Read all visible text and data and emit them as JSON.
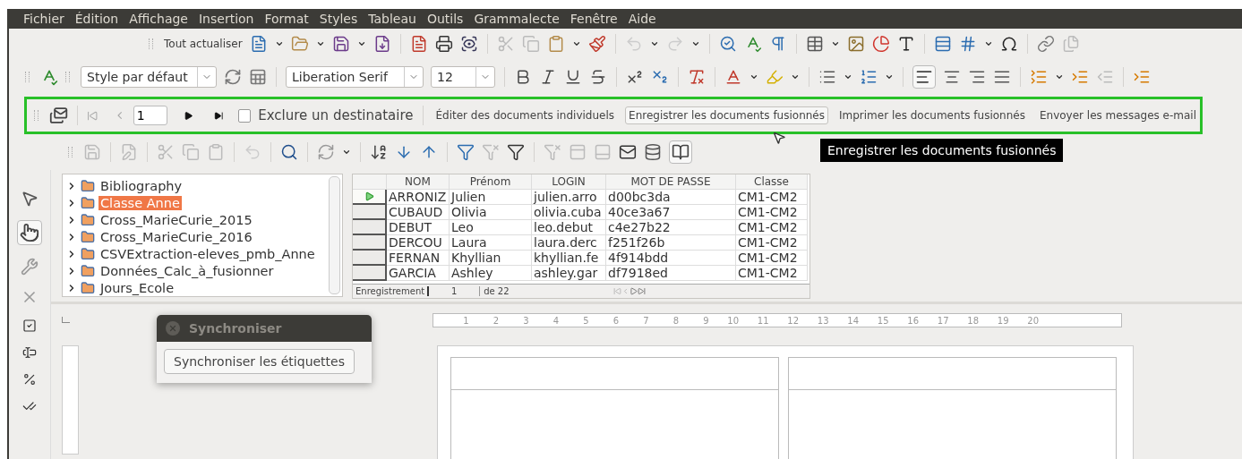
{
  "menu": [
    "Fichier",
    "Édition",
    "Affichage",
    "Insertion",
    "Format",
    "Styles",
    "Tableau",
    "Outils",
    "Grammalecte",
    "Fenêtre",
    "Aide"
  ],
  "standard_toolbar": {
    "update_all": "Tout actualiser"
  },
  "formatting_toolbar": {
    "paragraph_style": "Style par défaut",
    "font_name": "Liberation Serif",
    "font_size": "12"
  },
  "mail_merge_toolbar": {
    "record": "1",
    "exclude": {
      "label": "Exclure un destinataire",
      "checked": false
    },
    "actions": [
      {
        "label": "Éditer des documents individuels",
        "hovered": false
      },
      {
        "label": "Enregistrer les documents fusionnés",
        "hovered": true
      },
      {
        "label": "Imprimer les documents fusionnés",
        "hovered": false
      },
      {
        "label": "Envoyer les messages e-mail",
        "hovered": false
      }
    ]
  },
  "tooltip": "Enregistrer les documents fusionnés",
  "data_sources": {
    "items": [
      {
        "label": "Bibliography",
        "selected": false,
        "expanded": false
      },
      {
        "label": "Classe Anne",
        "selected": true,
        "expanded": false
      },
      {
        "label": "Cross_MarieCurie_2015",
        "selected": false,
        "expanded": false
      },
      {
        "label": "Cross_MarieCurie_2016",
        "selected": false,
        "expanded": false
      },
      {
        "label": "CSVExtraction-eleves_pmb_Anne",
        "selected": false,
        "expanded": false
      },
      {
        "label": "Données_Calc_à_fusionner",
        "selected": false,
        "expanded": false
      },
      {
        "label": "Jours_Ecole",
        "selected": false,
        "expanded": false
      }
    ]
  },
  "table": {
    "columns": [
      "NOM",
      "Prénom",
      "LOGIN",
      "MOT DE PASSE",
      "Classe"
    ],
    "rows": [
      {
        "selected": true,
        "cells": [
          "ARRONIZ",
          "Julien",
          "julien.arro",
          "d00bc3da",
          "CM1-CM2"
        ]
      },
      {
        "selected": false,
        "cells": [
          "CUBAUD",
          "Olivia",
          "olivia.cuba",
          "40ce3a67",
          "CM1-CM2"
        ]
      },
      {
        "selected": false,
        "cells": [
          "DEBUT",
          "Leo",
          "leo.debut",
          "c4e27b22",
          "CM1-CM2"
        ]
      },
      {
        "selected": false,
        "cells": [
          "DERCOU",
          "Laura",
          "laura.derc",
          "f251f26b",
          "CM1-CM2"
        ]
      },
      {
        "selected": false,
        "cells": [
          "FERNAN",
          "Khyllian",
          "khyllian.fe",
          "4f914bdd",
          "CM1-CM2"
        ]
      },
      {
        "selected": false,
        "cells": [
          "GARCIA",
          "Ashley",
          "ashley.gar",
          "df7918ed",
          "CM1-CM2"
        ]
      }
    ]
  },
  "record_bar": {
    "label": "Enregistrement",
    "value": "1",
    "total": "de 22"
  },
  "ruler": {
    "ticks": [
      "1",
      "2",
      "3",
      "4",
      "5",
      "6",
      "7",
      "8",
      "9",
      "10",
      "11",
      "12",
      "13",
      "14",
      "15",
      "16",
      "17",
      "18",
      "19",
      "20"
    ]
  },
  "dialog": {
    "title": "Synchroniser",
    "button": "Synchroniser les étiquettes"
  }
}
